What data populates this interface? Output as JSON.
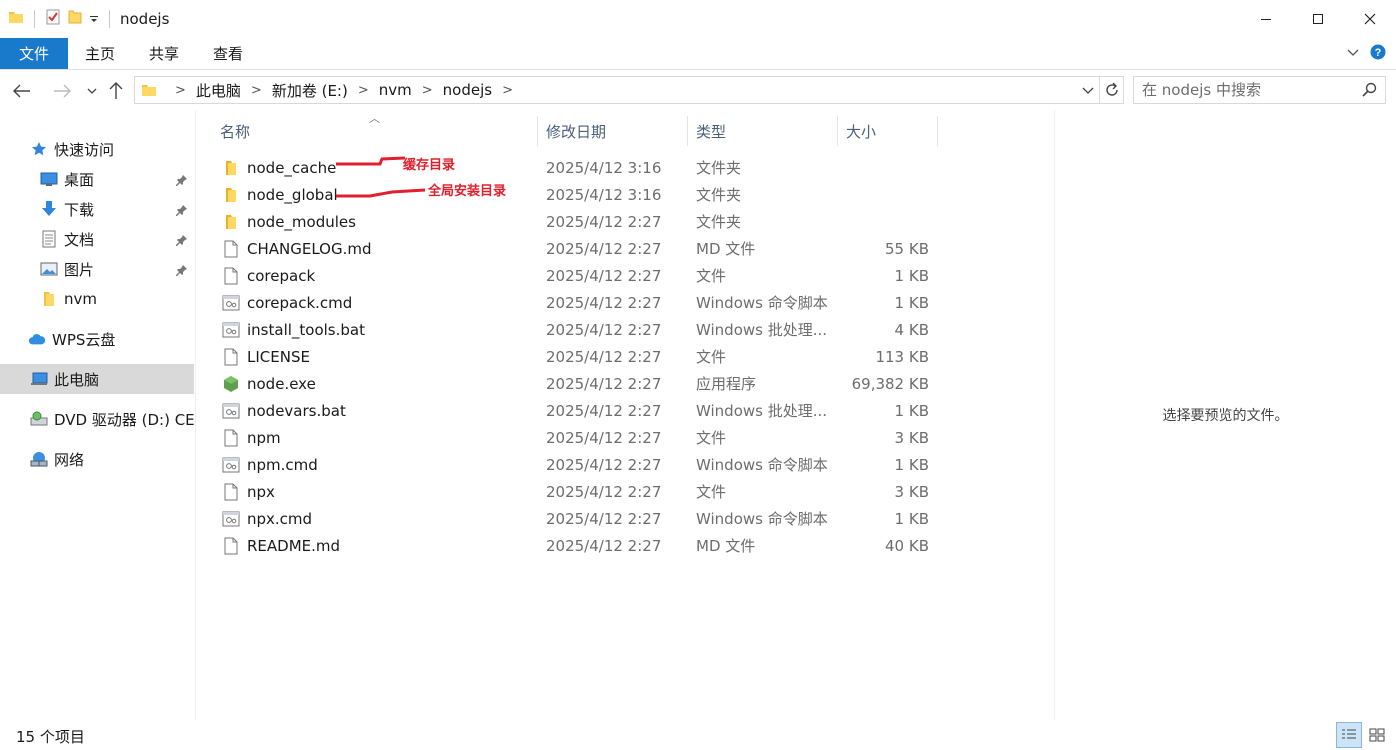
{
  "window": {
    "title": "nodejs"
  },
  "ribbon": {
    "tabs": [
      "文件",
      "主页",
      "共享",
      "查看"
    ]
  },
  "address": {
    "crumbs": [
      "此电脑",
      "新加卷 (E:)",
      "nvm",
      "nodejs"
    ],
    "search_placeholder": "在 nodejs 中搜索"
  },
  "sidebar": {
    "items": [
      {
        "label": "快速访问",
        "icon": "star-icon"
      },
      {
        "label": "桌面",
        "icon": "desktop-icon",
        "pinned": true
      },
      {
        "label": "下载",
        "icon": "download-icon",
        "pinned": true
      },
      {
        "label": "文档",
        "icon": "document-icon",
        "pinned": true
      },
      {
        "label": "图片",
        "icon": "pictures-icon",
        "pinned": true
      },
      {
        "label": "nvm",
        "icon": "folder-icon"
      },
      {
        "label": "WPS云盘",
        "icon": "cloud-icon"
      },
      {
        "label": "此电脑",
        "icon": "computer-icon",
        "selected": true
      },
      {
        "label": "DVD 驱动器 (D:) CES",
        "icon": "dvd-drive-icon"
      },
      {
        "label": "网络",
        "icon": "network-icon"
      }
    ]
  },
  "columns": {
    "name": "名称",
    "date": "修改日期",
    "type": "类型",
    "size": "大小"
  },
  "files": [
    {
      "name": "node_cache",
      "date": "2025/4/12 3:16",
      "type": "文件夹",
      "size": "",
      "icon": "folder-icon"
    },
    {
      "name": "node_global",
      "date": "2025/4/12 3:16",
      "type": "文件夹",
      "size": "",
      "icon": "folder-icon"
    },
    {
      "name": "node_modules",
      "date": "2025/4/12 2:27",
      "type": "文件夹",
      "size": "",
      "icon": "folder-icon"
    },
    {
      "name": "CHANGELOG.md",
      "date": "2025/4/12 2:27",
      "type": "MD 文件",
      "size": "55 KB",
      "icon": "file-icon"
    },
    {
      "name": "corepack",
      "date": "2025/4/12 2:27",
      "type": "文件",
      "size": "1 KB",
      "icon": "file-icon"
    },
    {
      "name": "corepack.cmd",
      "date": "2025/4/12 2:27",
      "type": "Windows 命令脚本",
      "size": "1 KB",
      "icon": "script-icon"
    },
    {
      "name": "install_tools.bat",
      "date": "2025/4/12 2:27",
      "type": "Windows 批处理...",
      "size": "4 KB",
      "icon": "script-icon"
    },
    {
      "name": "LICENSE",
      "date": "2025/4/12 2:27",
      "type": "文件",
      "size": "113 KB",
      "icon": "file-icon"
    },
    {
      "name": "node.exe",
      "date": "2025/4/12 2:27",
      "type": "应用程序",
      "size": "69,382 KB",
      "icon": "node-exe-icon"
    },
    {
      "name": "nodevars.bat",
      "date": "2025/4/12 2:27",
      "type": "Windows 批处理...",
      "size": "1 KB",
      "icon": "script-icon"
    },
    {
      "name": "npm",
      "date": "2025/4/12 2:27",
      "type": "文件",
      "size": "3 KB",
      "icon": "file-icon"
    },
    {
      "name": "npm.cmd",
      "date": "2025/4/12 2:27",
      "type": "Windows 命令脚本",
      "size": "1 KB",
      "icon": "script-icon"
    },
    {
      "name": "npx",
      "date": "2025/4/12 2:27",
      "type": "文件",
      "size": "3 KB",
      "icon": "file-icon"
    },
    {
      "name": "npx.cmd",
      "date": "2025/4/12 2:27",
      "type": "Windows 命令脚本",
      "size": "1 KB",
      "icon": "script-icon"
    },
    {
      "name": "README.md",
      "date": "2025/4/12 2:27",
      "type": "MD 文件",
      "size": "40 KB",
      "icon": "file-icon"
    }
  ],
  "preview": {
    "empty_text": "选择要预览的文件。"
  },
  "status": {
    "item_count": "15 个项目"
  },
  "annotations": {
    "cache_label": "缓存目录",
    "global_label": "全局安装目录",
    "color": "#e0202c"
  },
  "colors": {
    "accent": "#1979ca",
    "selected_bg": "#d9d9d9",
    "header_text": "#4c607a"
  }
}
